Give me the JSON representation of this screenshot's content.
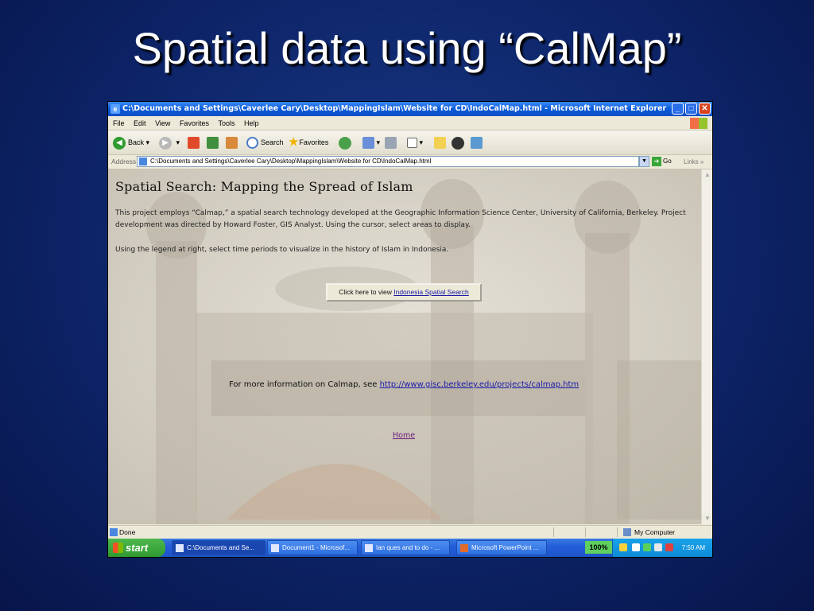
{
  "slide": {
    "title": "Spatial data using “CalMap”"
  },
  "window": {
    "title": "C:\\Documents and Settings\\Caverlee Cary\\Desktop\\MappingIslam\\Website for CD\\IndoCalMap.html - Microsoft Internet Explorer"
  },
  "menu": [
    "File",
    "Edit",
    "View",
    "Favorites",
    "Tools",
    "Help"
  ],
  "toolbar": {
    "back": "Back",
    "search": "Search",
    "favorites": "Favorites"
  },
  "address": {
    "label": "Address",
    "value": "C:\\Documents and Settings\\Caverlee Cary\\Desktop\\MappingIslam\\Website for CD\\IndoCalMap.html",
    "go": "Go",
    "links": "Links"
  },
  "page": {
    "heading": "Spatial Search: Mapping the Spread of Islam",
    "intro": "This project employs “Calmap,” a spatial search technology developed at the Geographic Information Science Center, University of California, Berkeley. Project development was directed by Howard Foster, GIS Analyst. Using the cursor, select areas to display.",
    "legend_note": "Using the legend at right, select time periods to visualize in the history of Islam in Indonesia.",
    "view_button_prefix": "Click here to view",
    "view_button_link": "Indonesia Spatial Search",
    "more_info_prefix": "For more information on Calmap, see",
    "more_info_link": "http://www.gisc.berkeley.edu/projects/calmap.htm",
    "home_link": "Home"
  },
  "status": {
    "text": "Done",
    "zone": "My Computer"
  },
  "taskbar": {
    "start": "start",
    "tasks": [
      "C:\\Documents and Se...",
      "Document1 - Microsof...",
      "Ian ques and to do - ...",
      "Microsoft PowerPoint ..."
    ],
    "zoom": "100%",
    "clock": "7:50 AM"
  },
  "icons": {
    "back": "back-arrow-icon",
    "forward": "forward-arrow-icon",
    "stop": "stop-icon",
    "refresh": "refresh-icon",
    "home": "home-icon",
    "search": "search-icon",
    "favorites": "star-icon",
    "history": "history-icon",
    "mail": "mail-icon",
    "print": "print-icon"
  }
}
